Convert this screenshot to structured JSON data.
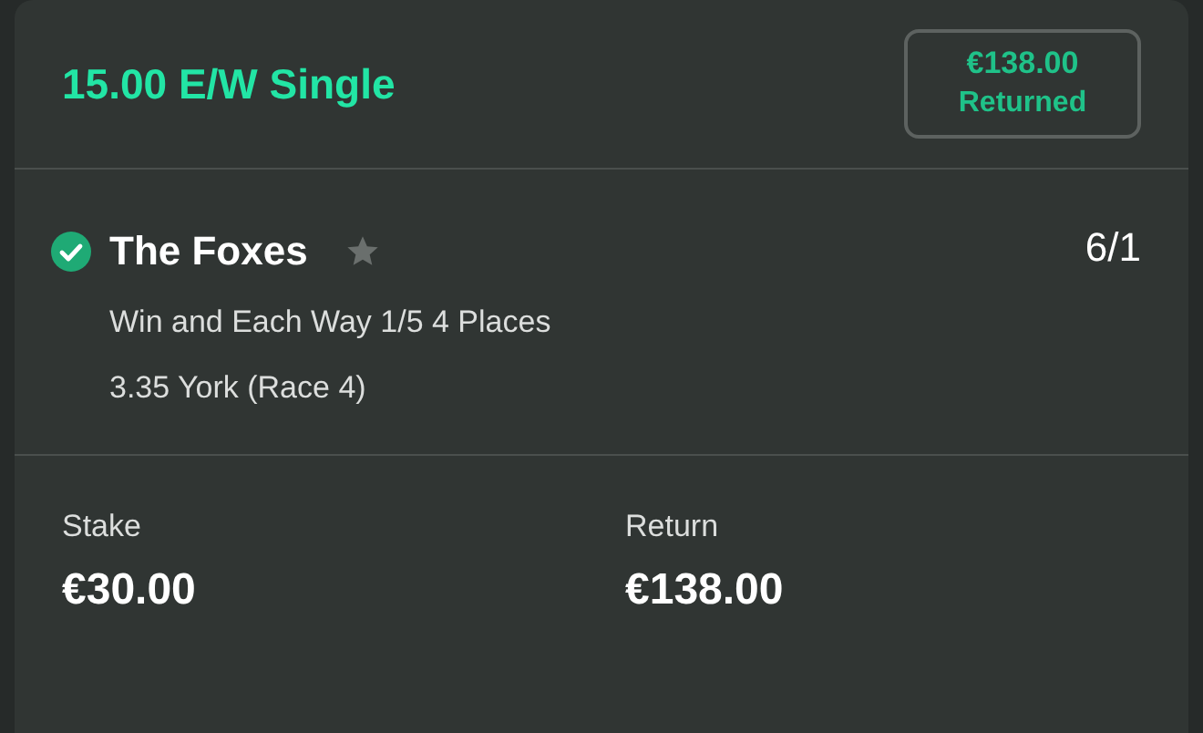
{
  "bet": {
    "title": "15.00 E/W Single",
    "badge": {
      "amount": "€138.00",
      "label": "Returned"
    }
  },
  "selection": {
    "name": "The Foxes",
    "won": true,
    "favourite": false,
    "odds": "6/1",
    "market": "Win and Each Way 1/5 4 Places",
    "event": "3.35 York (Race 4)"
  },
  "totals": [
    {
      "label": "Stake",
      "value": "€30.00"
    },
    {
      "label": "Return",
      "value": "€138.00"
    }
  ]
}
